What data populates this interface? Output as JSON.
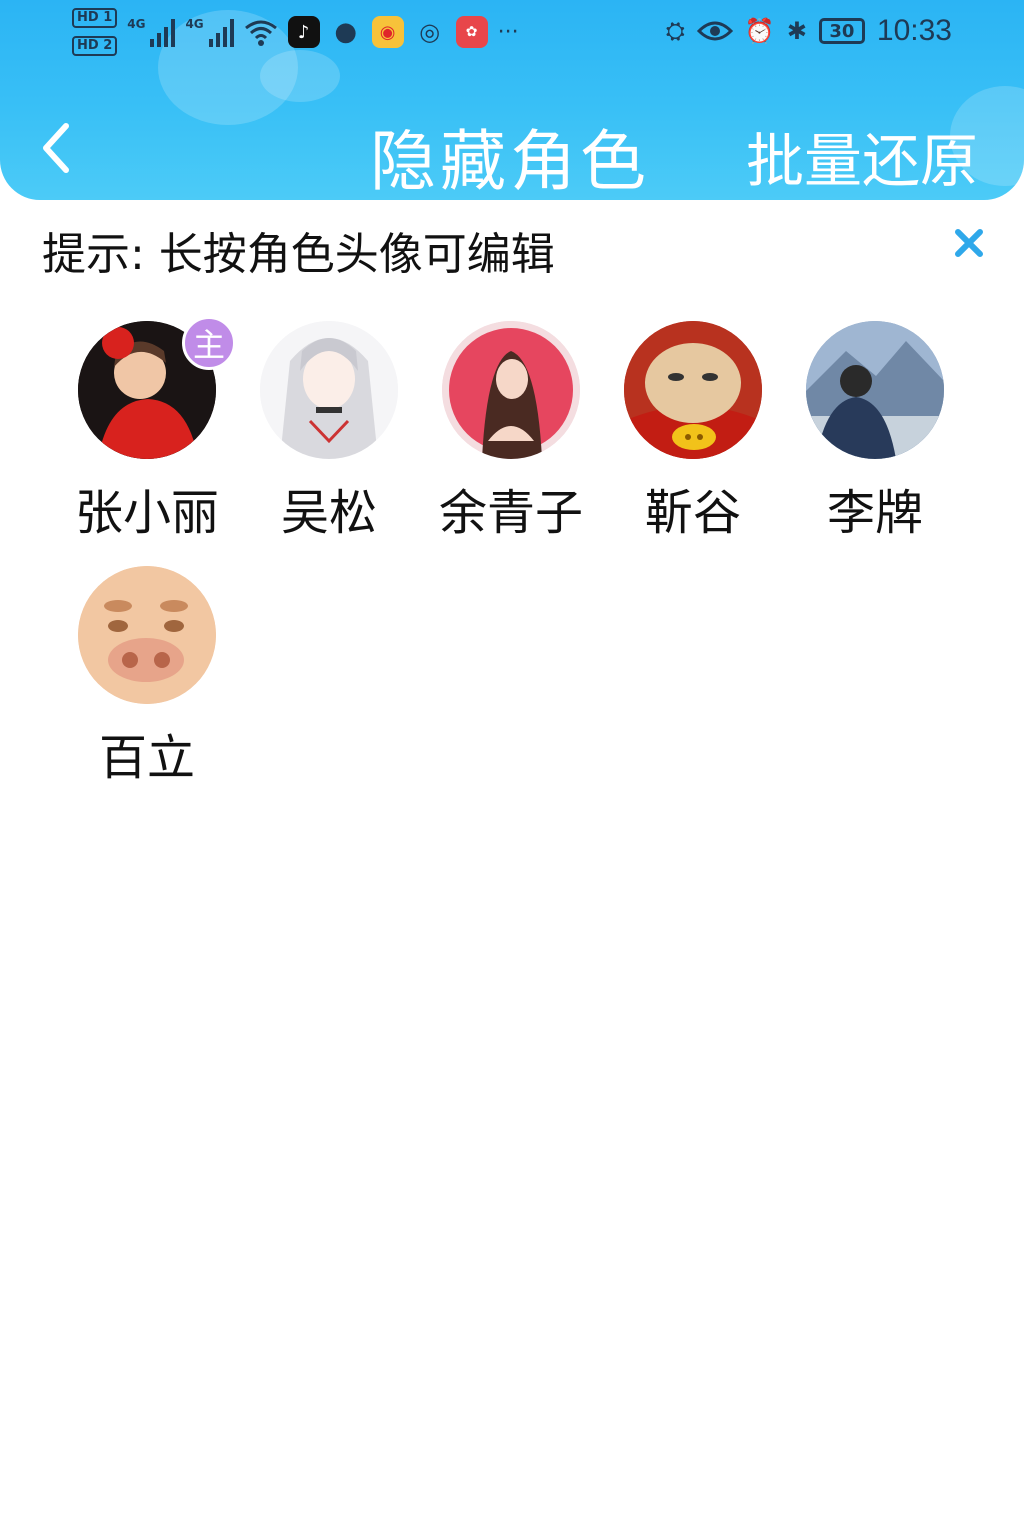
{
  "status_bar": {
    "sim1": "HD 1",
    "sim2": "HD 2",
    "net1": "4G",
    "net2": "4G",
    "more": "···",
    "battery": "30",
    "time": "10:33"
  },
  "header": {
    "title": "隐藏角色",
    "batch_restore": "批量还原"
  },
  "hint": {
    "text": "提示: 长按角色头像可编辑"
  },
  "badge_label": "主",
  "characters": [
    {
      "name": "张小丽",
      "is_main": true
    },
    {
      "name": "吴松"
    },
    {
      "name": "余青子"
    },
    {
      "name": "靳谷"
    },
    {
      "name": "李牌"
    },
    {
      "name": "百立"
    }
  ],
  "colors": {
    "header": "#2bb4f4",
    "close": "#2fa8ea",
    "badge": "#c08ce8"
  }
}
